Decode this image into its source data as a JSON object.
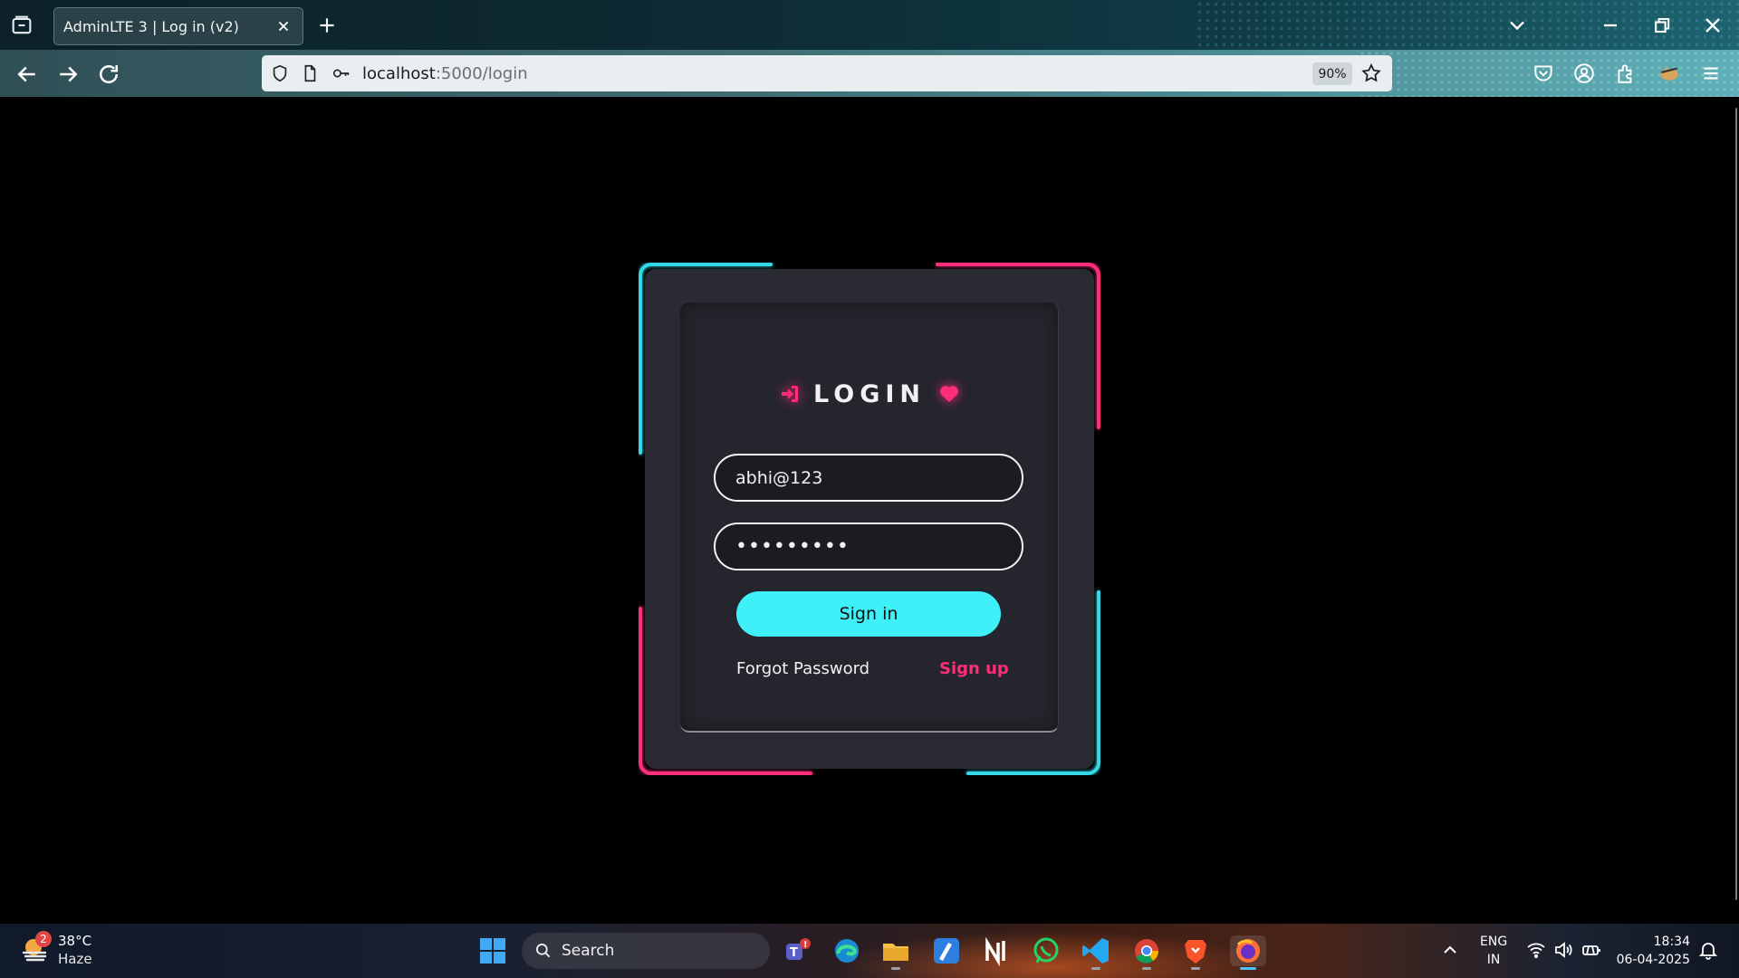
{
  "browser": {
    "tab_title": "AdminLTE 3 | Log in (v2)",
    "url_host": "localhost",
    "url_path": ":5000/login",
    "zoom": "90%"
  },
  "login": {
    "title": "LOGIN",
    "username_value": "abhi@123",
    "password_value": "•••••••••",
    "signin_label": "Sign in",
    "forgot_label": "Forgot Password",
    "signup_label": "Sign up",
    "colors": {
      "accent_pink": "#ff2d7a",
      "accent_cyan": "#3ff0f9",
      "card": "#2a2a33"
    }
  },
  "taskbar": {
    "weather_badge": "2",
    "weather_temp": "38°C",
    "weather_cond": "Haze",
    "search_label": "Search",
    "lang_line1": "ENG",
    "lang_line2": "IN",
    "time": "18:34",
    "date": "06-04-2025",
    "apps": [
      "teams-icon",
      "edge-icon",
      "file-explorer-icon",
      "pen-app-icon",
      "notion-icon",
      "whatsapp-icon",
      "vscode-icon",
      "chrome-icon",
      "brave-icon",
      "firefox-icon"
    ]
  }
}
